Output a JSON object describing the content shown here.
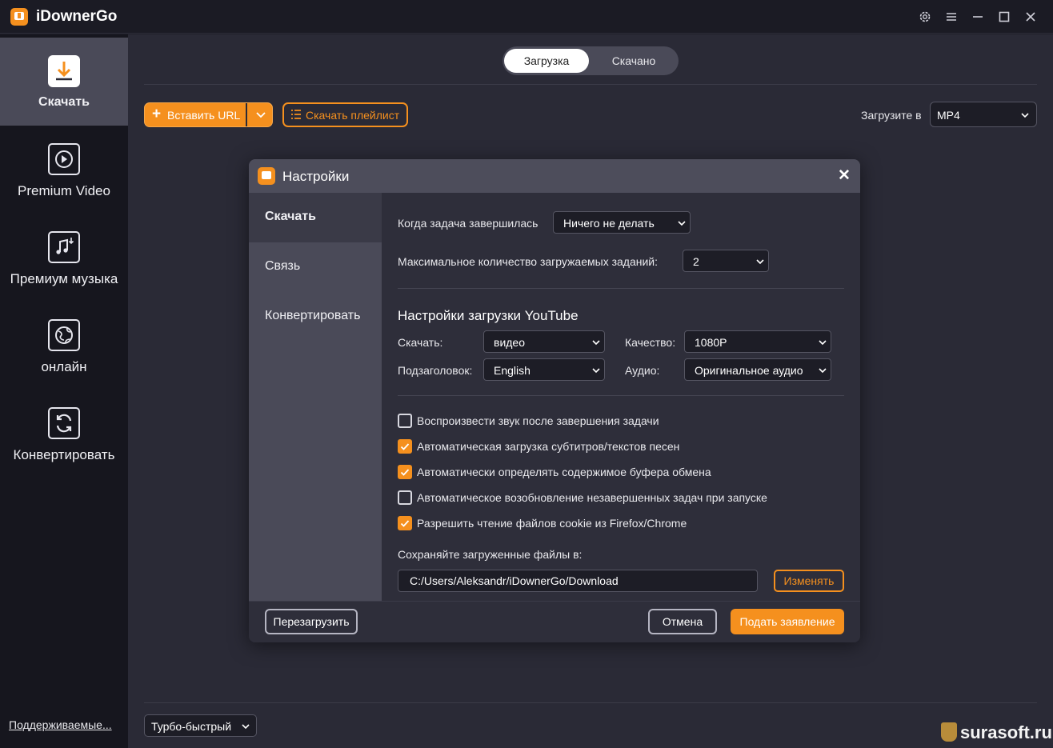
{
  "app": {
    "title": "iDownerGo"
  },
  "titlebar": {
    "settings_icon": "gear-icon",
    "menu_icon": "menu-icon",
    "minimize_icon": "minimize-icon",
    "maximize_icon": "maximize-icon",
    "close_icon": "close-icon"
  },
  "sidebar": {
    "items": [
      {
        "label": "Скачать",
        "icon": "download-icon",
        "active": true
      },
      {
        "label": "Premium Video",
        "icon": "play-icon"
      },
      {
        "label": "Премиум музыка",
        "icon": "music-icon"
      },
      {
        "label": "онлайн",
        "icon": "globe-icon"
      },
      {
        "label": "Конвертировать",
        "icon": "convert-icon"
      }
    ],
    "supported_link": "Поддерживаемые..."
  },
  "main": {
    "tabs": [
      {
        "label": "Загрузка",
        "active": true
      },
      {
        "label": "Скачано"
      }
    ],
    "paste_url_label": "Вставить URL",
    "playlist_label": "Скачать плейлист",
    "format_label": "Загрузите в",
    "format_value": "MP4",
    "speed_value": "Турбо-быстрый"
  },
  "dialog": {
    "title": "Настройки",
    "nav": [
      {
        "label": "Скачать",
        "active": true
      },
      {
        "label": "Связь"
      },
      {
        "label": "Конвертировать"
      }
    ],
    "task_done_label": "Когда задача завершилась",
    "task_done_value": "Ничего не делать",
    "max_tasks_label": "Максимальное количество загружаемых заданий:",
    "max_tasks_value": "2",
    "youtube_title": "Настройки загрузки YouTube",
    "download_label": "Скачать:",
    "download_value": "видео",
    "quality_label": "Качество:",
    "quality_value": "1080P",
    "subtitle_label": "Подзаголовок:",
    "subtitle_value": "English",
    "audio_label": "Аудио:",
    "audio_value": "Оригинальное аудио",
    "checkboxes": [
      {
        "label": "Воспроизвести звук после завершения задачи",
        "checked": false
      },
      {
        "label": "Автоматическая загрузка субтитров/текстов песен",
        "checked": true
      },
      {
        "label": "Автоматически определять содержимое буфера обмена",
        "checked": true
      },
      {
        "label": "Автоматическое возобновление незавершенных задач при запуске",
        "checked": false
      },
      {
        "label": "Разрешить чтение файлов cookie из Firefox/Chrome",
        "checked": true
      }
    ],
    "save_path_label": "Сохраняйте загруженные файлы в:",
    "save_path_value": "C:/Users/Aleksandr/iDownerGo/Download",
    "change_label": "Изменять",
    "reset_label": "Перезагрузить",
    "cancel_label": "Отмена",
    "apply_label": "Подать заявление"
  },
  "watermark": "surasoft.ru",
  "colors": {
    "accent": "#f5901e",
    "background": "#2a2a36",
    "sidebar": "#16161e",
    "dialog": "#2e2e3a"
  }
}
